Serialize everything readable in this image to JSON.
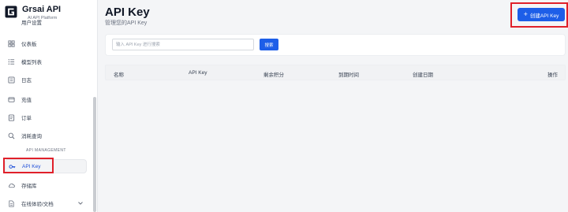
{
  "brand": {
    "title": "Grsai API",
    "subtitle": "AI API Platform"
  },
  "sidebar": {
    "items": [
      {
        "label": "用户设置",
        "icon": "user-icon"
      },
      {
        "label": "仪表板",
        "icon": "dashboard-icon"
      },
      {
        "label": "模型列表",
        "icon": "list-icon"
      },
      {
        "label": "日志",
        "icon": "log-icon"
      },
      {
        "label": "充值",
        "icon": "wallet-icon"
      },
      {
        "label": "订单",
        "icon": "order-icon"
      },
      {
        "label": "消耗查询",
        "icon": "search-icon"
      }
    ],
    "section_label": "API MANAGEMENT",
    "api_items": [
      {
        "label": "API Key",
        "icon": "key-icon",
        "active": true
      },
      {
        "label": "存储库",
        "icon": "cloud-icon"
      },
      {
        "label": "在线体验/文档",
        "icon": "document-icon"
      }
    ]
  },
  "header": {
    "title": "API Key",
    "subtitle": "管理您的API Key",
    "create_button": "创建API Key",
    "create_icon": "plus-icon"
  },
  "search": {
    "placeholder": "输入 API Key 进行搜索",
    "value": "",
    "button": "搜索"
  },
  "table": {
    "columns": [
      "名称",
      "API Key",
      "剩余积分",
      "到期时间",
      "创建日期",
      "操作"
    ],
    "rows": []
  },
  "colors": {
    "accent": "#1d5ee8",
    "highlight": "#e0202a"
  }
}
